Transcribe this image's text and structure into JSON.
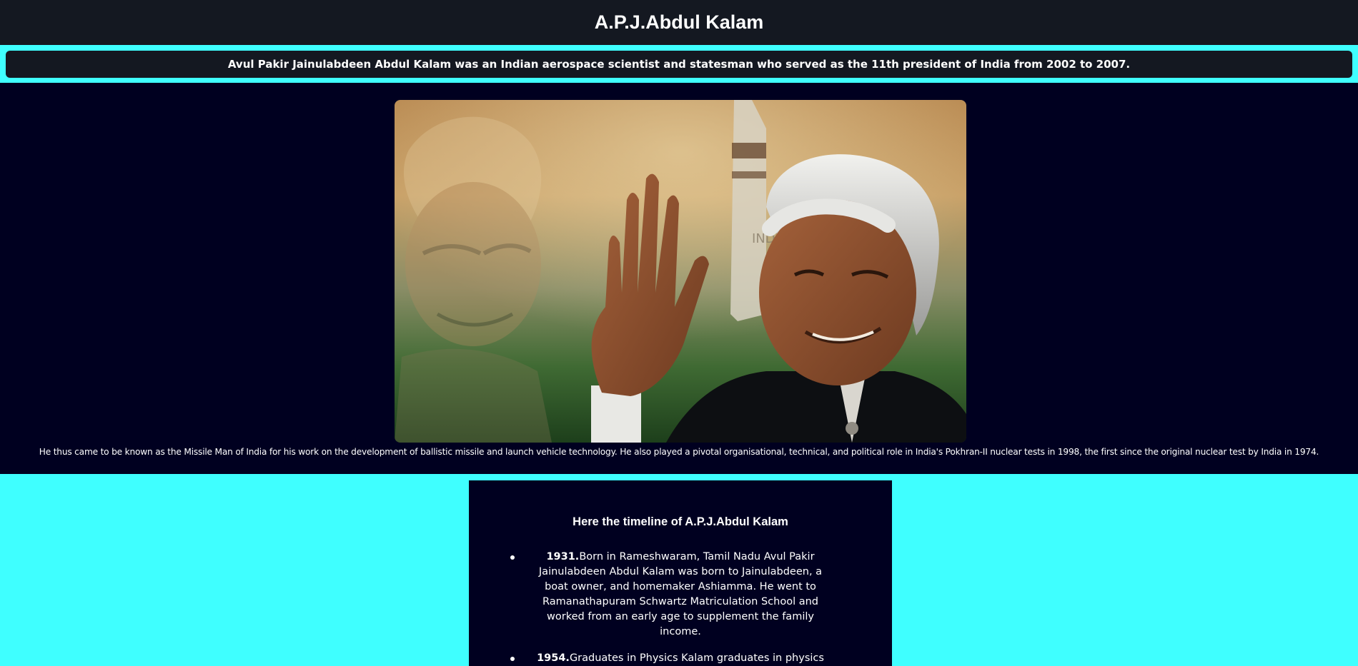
{
  "header": {
    "title": "A.P.J.Abdul Kalam"
  },
  "intro": {
    "text": "Avul Pakir Jainulabdeen Abdul Kalam was an Indian aerospace scientist and statesman who served as the 11th president of India from 2002 to 2007."
  },
  "hero": {
    "image_subject": "portrait-of-kalam-waving-with-missile",
    "rocket_text": "INDIA",
    "caption": "He thus came to be known as the Missile Man of India for his work on the development of ballistic missile and launch vehicle technology. He also played a pivotal organisational, technical, and political role in India's Pokhran-II nuclear tests in 1998, the first since the original nuclear test by India in 1974."
  },
  "timeline": {
    "heading": "Here the timeline of A.P.J.Abdul Kalam",
    "items": [
      {
        "year": "1931.",
        "text": "Born in Rameshwaram, Tamil Nadu Avul Pakir Jainulabdeen Abdul Kalam was born to Jainulabdeen, a boat owner, and homemaker Ashiamma. He went to Ramanathapuram Schwartz Matriculation School and worked from an early age to supplement the family income."
      },
      {
        "year": "1954.",
        "text": "Graduates in Physics Kalam graduates in physics from"
      }
    ]
  },
  "colors": {
    "page_background": "#3fffff",
    "header_background": "#141821",
    "hero_background": "#000020",
    "text": "#ffffff"
  }
}
